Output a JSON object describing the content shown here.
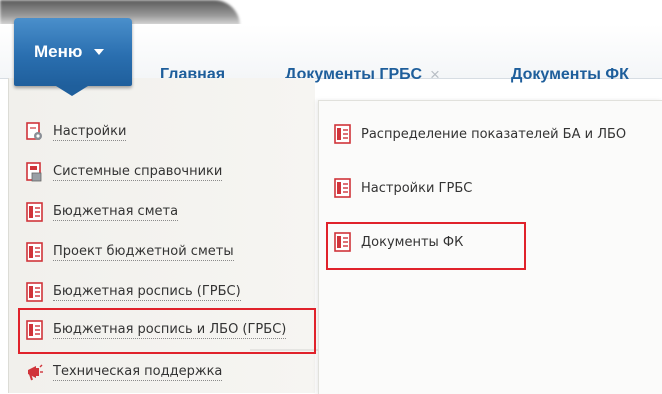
{
  "header": {
    "menu_label": "Меню",
    "tabs": [
      {
        "label": "Главная",
        "closable": false
      },
      {
        "label": "Документы ГРБС",
        "closable": true,
        "close_glyph": "×"
      },
      {
        "label": "Документы ФК",
        "closable": false
      }
    ]
  },
  "left_menu": {
    "items": [
      {
        "label": "Настройки",
        "icon": "settings-gear-doc-icon"
      },
      {
        "label": "Системные справочники",
        "icon": "reference-book-icon"
      },
      {
        "label": "Бюджетная смета",
        "icon": "document-red-icon"
      },
      {
        "label": "Проект бюджетной сметы",
        "icon": "document-red-icon"
      },
      {
        "label": "Бюджетная роспись (ГРБС)",
        "icon": "document-red-icon"
      },
      {
        "label": "Бюджетная роспись и ЛБО (ГРБС)",
        "icon": "document-red-icon",
        "highlighted": true
      },
      {
        "label": "Техническая поддержка",
        "icon": "support-megaphone-icon"
      }
    ]
  },
  "right_menu": {
    "items": [
      {
        "label": "Распределение показателей БА и ЛБО",
        "icon": "document-red-icon"
      },
      {
        "label": "Настройки ГРБС",
        "icon": "document-red-icon"
      },
      {
        "label": "Документы ФК",
        "icon": "document-red-icon",
        "highlighted": true
      }
    ]
  },
  "colors": {
    "accent_blue": "#2a6fb0",
    "tab_text": "#1e5e9b",
    "highlight_red": "#e0222b",
    "icon_red": "#d0343a"
  }
}
